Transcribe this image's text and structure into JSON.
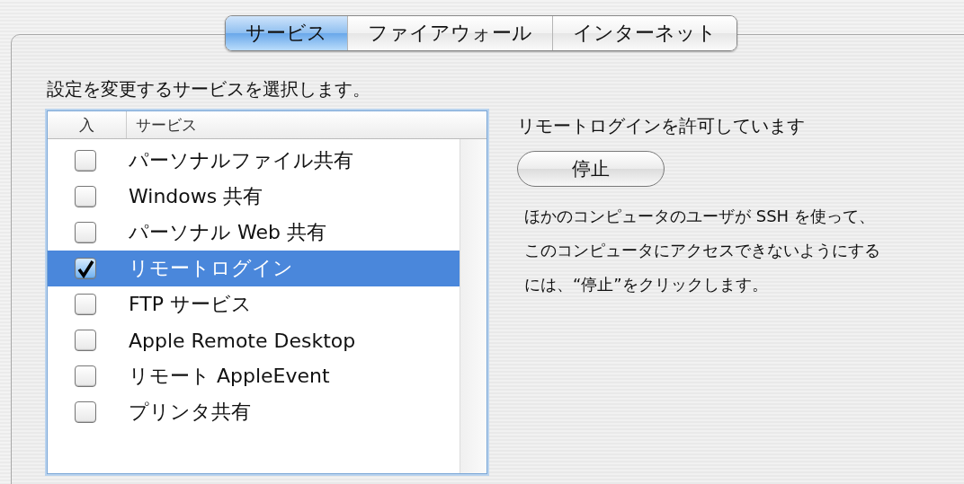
{
  "tabs": [
    {
      "label": "サービス",
      "selected": true
    },
    {
      "label": "ファイアウォール",
      "selected": false
    },
    {
      "label": "インターネット",
      "selected": false
    }
  ],
  "instruction": "設定を変更するサービスを選択します。",
  "services_table": {
    "columns": [
      "入",
      "サービス"
    ],
    "rows": [
      {
        "name": "パーソナルファイル共有",
        "checked": false,
        "selected": false
      },
      {
        "name": "Windows 共有",
        "checked": false,
        "selected": false
      },
      {
        "name": "パーソナル Web 共有",
        "checked": false,
        "selected": false
      },
      {
        "name": "リモートログイン",
        "checked": true,
        "selected": true
      },
      {
        "name": "FTP サービス",
        "checked": false,
        "selected": false
      },
      {
        "name": "Apple Remote Desktop",
        "checked": false,
        "selected": false
      },
      {
        "name": "リモート AppleEvent",
        "checked": false,
        "selected": false
      },
      {
        "name": "プリンタ共有",
        "checked": false,
        "selected": false
      }
    ]
  },
  "detail": {
    "status": "リモートログインを許可しています",
    "button": "停止",
    "description_lines": [
      "ほかのコンピュータのユーザが SSH を使って、",
      "このコンピュータにアクセスできないようにする",
      "には、“停止”をクリックします。"
    ]
  }
}
